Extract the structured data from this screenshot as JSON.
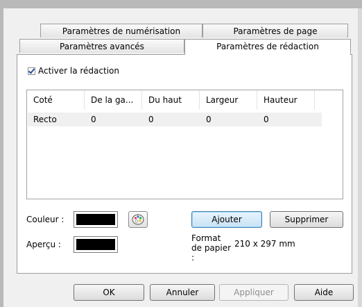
{
  "tabs": {
    "row_back": [
      "Paramètres de numérisation",
      "Paramètres de page"
    ],
    "row_front": [
      "Paramètres avancés",
      "Paramètres de rédaction"
    ],
    "active": "Paramètres de rédaction"
  },
  "redaction": {
    "enable_label": "Activer la rédaction",
    "enable_checked": true,
    "table": {
      "columns": [
        "Coté",
        "De la ga...",
        "Du haut",
        "Largeur",
        "Hauteur"
      ],
      "rows": [
        [
          "Recto",
          "0",
          "0",
          "0",
          "0"
        ]
      ]
    },
    "color_label": "Couleur :",
    "color_value": "#000000",
    "preview_label": "Aperçu :",
    "preview_value": "#000000",
    "palette_icon": "color-palette-icon",
    "add_label": "Ajouter",
    "delete_label": "Supprimer",
    "paper_format_label": "Format de papier :",
    "paper_format_value": "210 x 297 mm"
  },
  "dialog_buttons": {
    "ok": "OK",
    "cancel": "Annuler",
    "apply": "Appliquer",
    "help": "Aide"
  }
}
